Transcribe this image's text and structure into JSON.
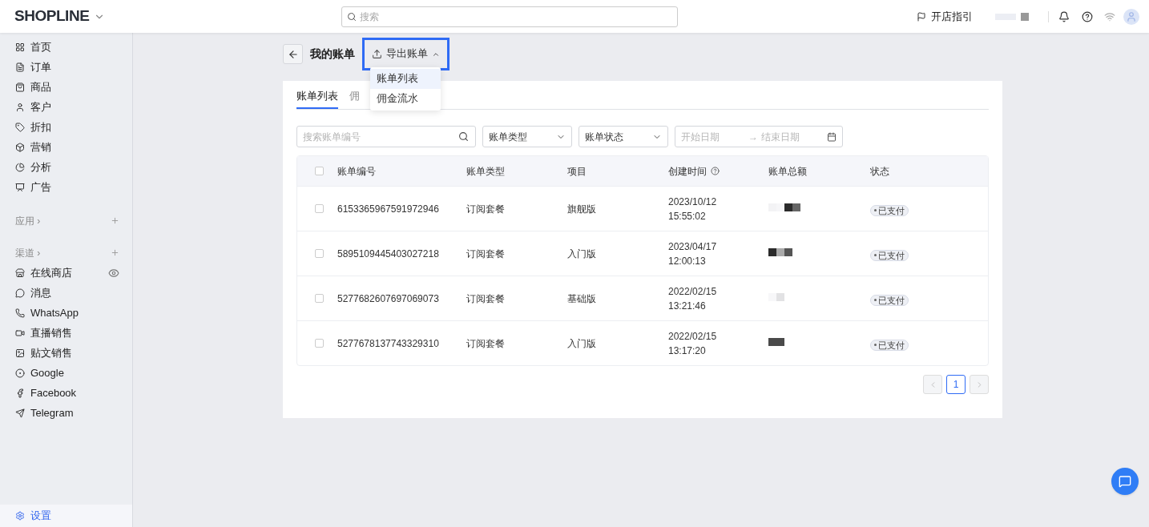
{
  "header": {
    "logo": "SHOPLINE",
    "search_placeholder": "搜索",
    "guide": "开店指引"
  },
  "sidebar": {
    "items": [
      {
        "label": "首页"
      },
      {
        "label": "订单"
      },
      {
        "label": "商品"
      },
      {
        "label": "客户"
      },
      {
        "label": "折扣"
      },
      {
        "label": "营销"
      },
      {
        "label": "分析"
      },
      {
        "label": "广告"
      }
    ],
    "apps_section": "应用 ›",
    "channels_section": "渠道 ›",
    "channels": [
      {
        "label": "在线商店",
        "eye": true
      },
      {
        "label": "消息",
        "eye": false
      },
      {
        "label": "WhatsApp",
        "eye": false
      },
      {
        "label": "直播销售",
        "eye": false
      },
      {
        "label": "贴文销售",
        "eye": false
      },
      {
        "label": "Google",
        "eye": false
      },
      {
        "label": "Facebook",
        "eye": false
      },
      {
        "label": "Telegram",
        "eye": false
      }
    ],
    "settings": {
      "label": "设置",
      "selected": true
    }
  },
  "page": {
    "title": "我的账单",
    "export_button": "导出账单",
    "export_menu": [
      {
        "label": "账单列表",
        "selected": true
      },
      {
        "label": "佣金流水",
        "selected": false
      }
    ]
  },
  "tabs": [
    {
      "label": "账单列表",
      "selected": true
    },
    {
      "label": "佣",
      "selected": false
    }
  ],
  "filters": {
    "search_placeholder": "搜索账单编号",
    "type": "账单类型",
    "status": "账单状态",
    "start_placeholder": "开始日期",
    "arrow": "→",
    "end_placeholder": "结束日期"
  },
  "table": {
    "all_checked": false,
    "columns": [
      "账单编号",
      "账单类型",
      "项目",
      "创建时间",
      "账单总额",
      "状态"
    ],
    "rows": [
      {
        "id": "6153365967591972946",
        "type": "订阅套餐",
        "item": "旗舰版",
        "date": "2023/10/12",
        "time": "15:55:02",
        "status": "已支付",
        "checked": false
      },
      {
        "id": "5895109445403027218",
        "type": "订阅套餐",
        "item": "入门版",
        "date": "2023/04/17",
        "time": "12:00:13",
        "status": "已支付",
        "checked": false
      },
      {
        "id": "5277682607697069073",
        "type": "订阅套餐",
        "item": "基础版",
        "date": "2022/02/15",
        "time": "13:21:46",
        "status": "已支付",
        "checked": false
      },
      {
        "id": "5277678137743329310",
        "type": "订阅套餐",
        "item": "入门版",
        "date": "2022/02/15",
        "time": "13:17:20",
        "status": "已支付",
        "checked": false
      }
    ]
  },
  "pagination": {
    "pages": [
      {
        "label": "1",
        "selected": true
      }
    ]
  }
}
